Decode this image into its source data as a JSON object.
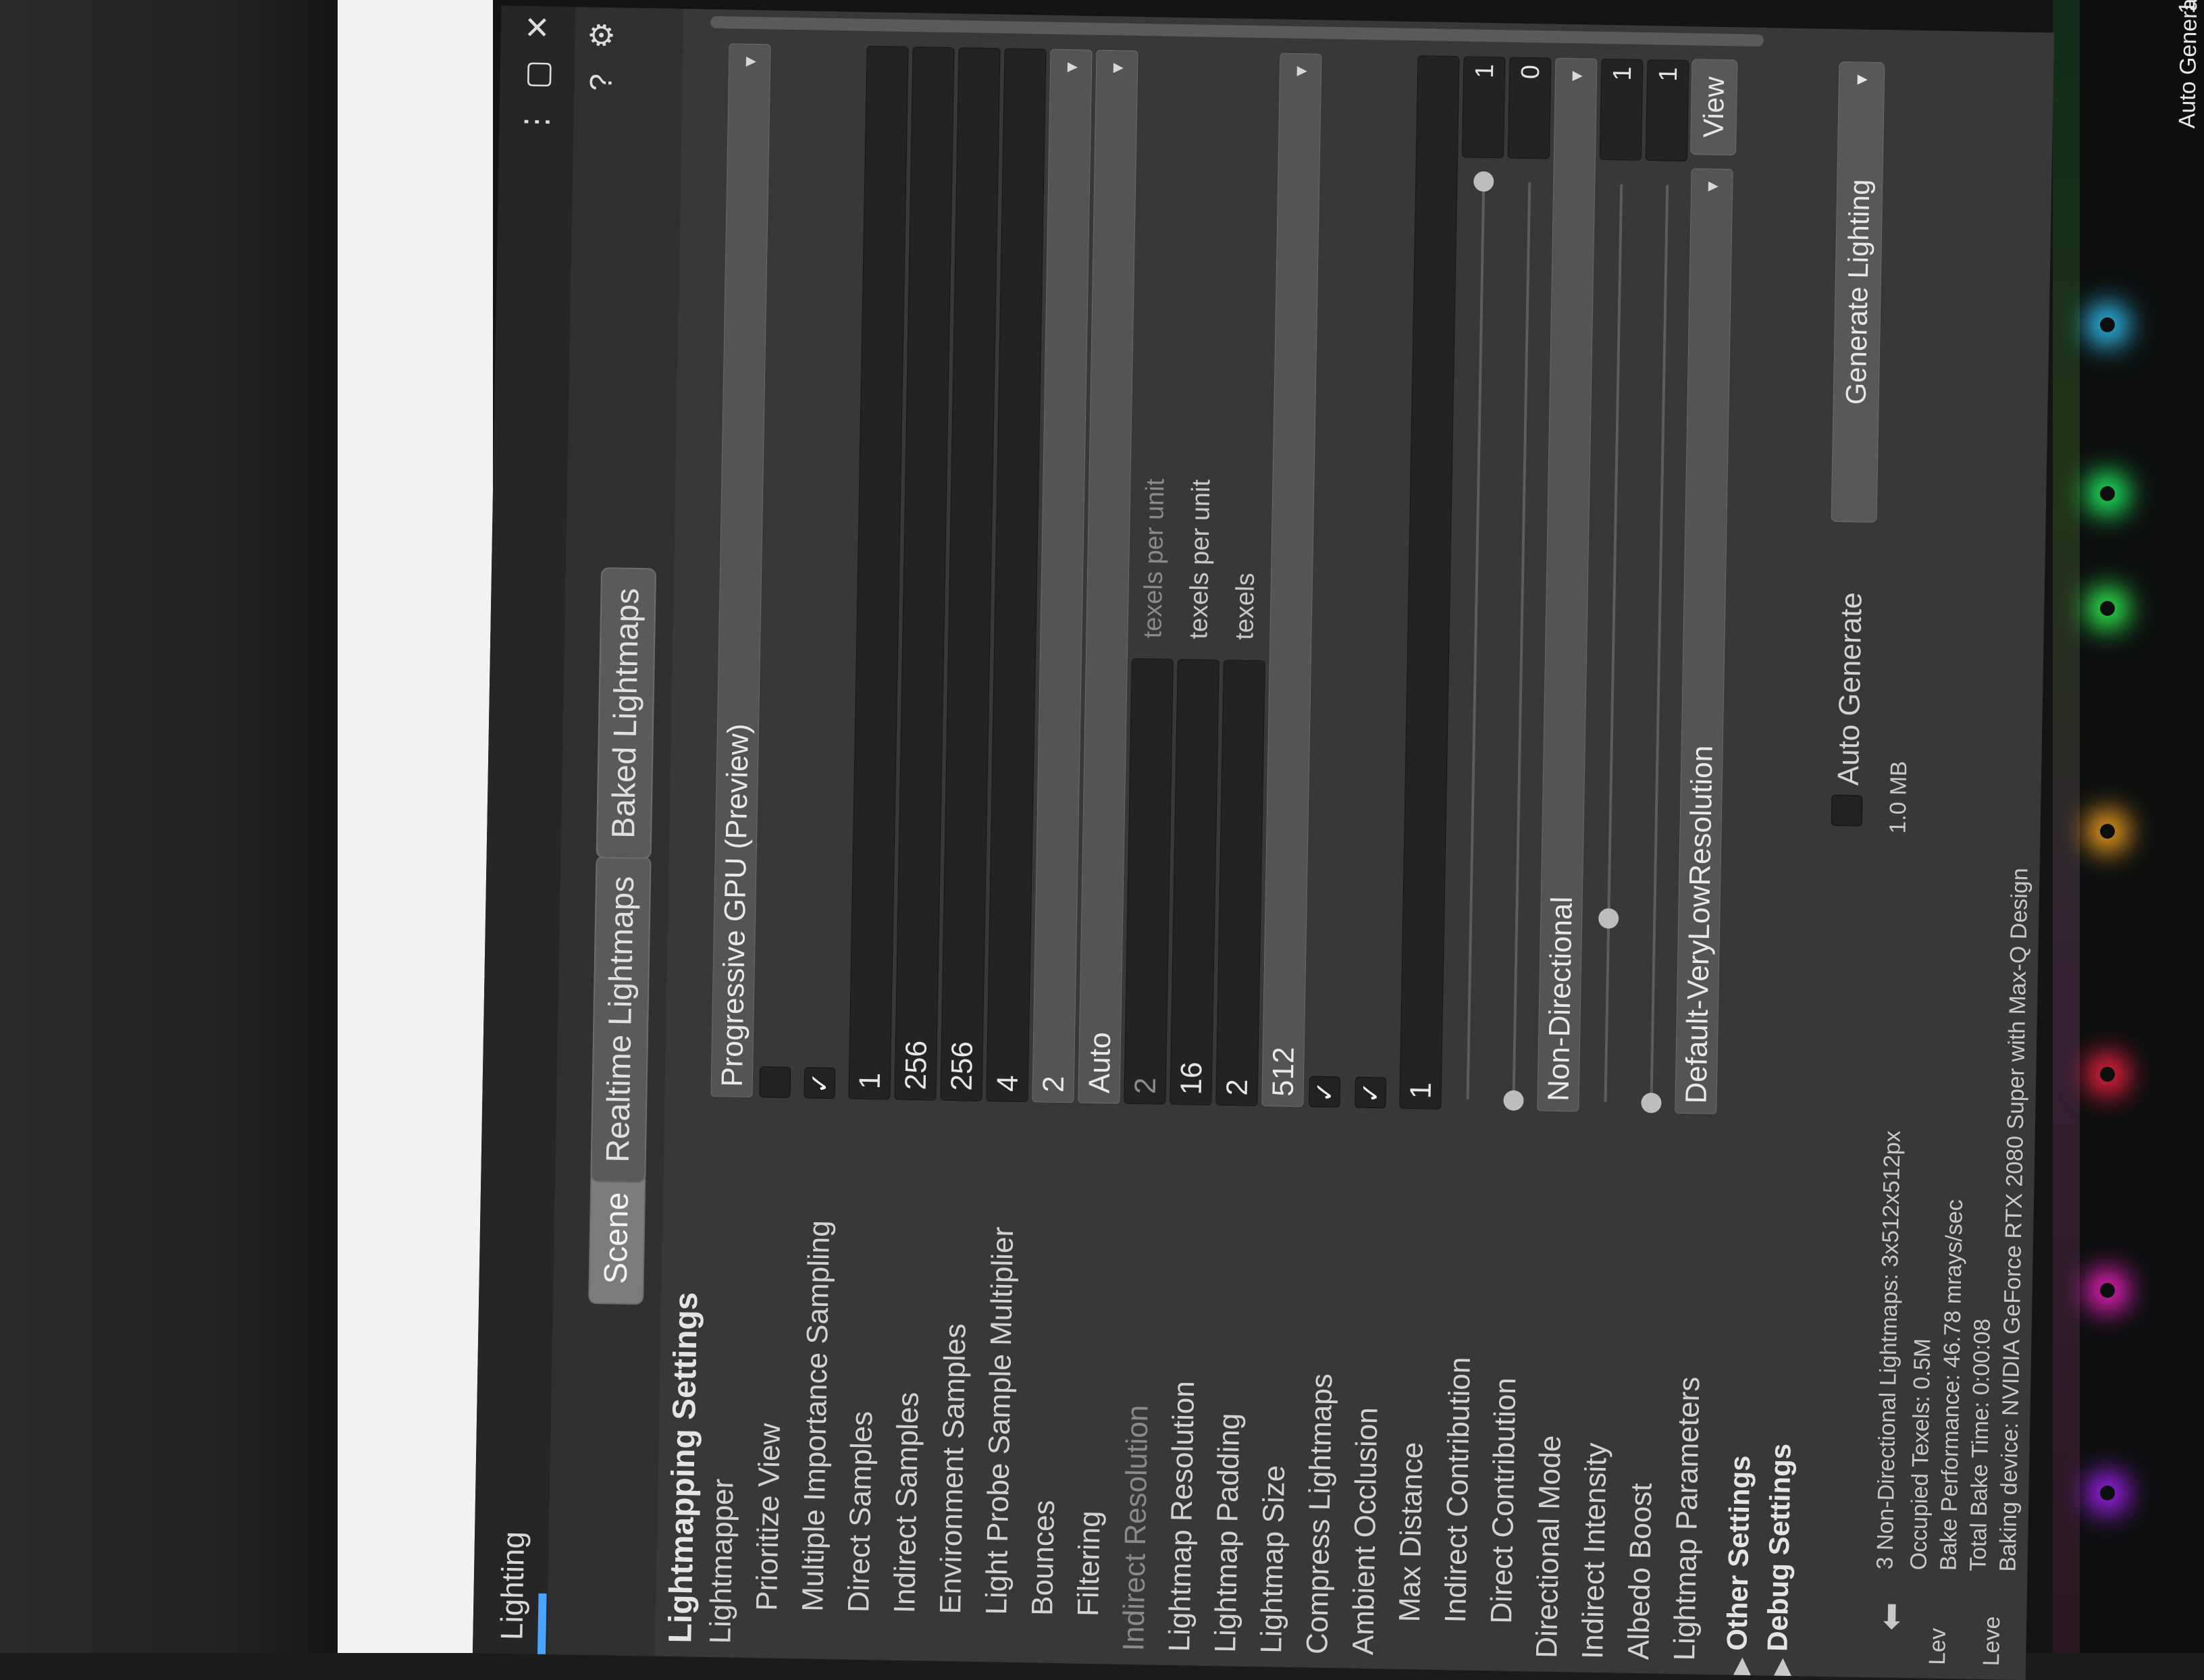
{
  "window": {
    "title": "Lighting",
    "menu_icon": "kebab-menu-icon",
    "maximize_icon": "maximize-icon",
    "close_icon": "close-icon",
    "close_glyph": "✕",
    "help_icon": "help-icon",
    "help_glyph": "?",
    "settings_icon": "gear-icon",
    "settings_glyph": "⚙",
    "kebab_glyph": "⋮",
    "maximize_glyph": "▢",
    "accent_color": "#4aa3ff"
  },
  "tabs": [
    {
      "label": "Scene",
      "active": true
    },
    {
      "label": "Realtime Lightmaps",
      "active": false
    },
    {
      "label": "Baked Lightmaps",
      "active": false
    }
  ],
  "section": {
    "title": "Lightmapping Settings"
  },
  "rows": {
    "lightmapper": {
      "label": "Lightmapper",
      "value": "Progressive GPU (Preview)"
    },
    "prioritize_view": {
      "label": "Prioritize View",
      "checked": false
    },
    "mis": {
      "label": "Multiple Importance Sampling",
      "checked": true,
      "glyph": "✓"
    },
    "direct_samples": {
      "label": "Direct Samples",
      "value": "1"
    },
    "indirect_samples": {
      "label": "Indirect Samples",
      "value": "256"
    },
    "environment_samples": {
      "label": "Environment Samples",
      "value": "256"
    },
    "probe_multiplier": {
      "label": "Light Probe Sample Multiplier",
      "value": "4"
    },
    "bounces": {
      "label": "Bounces",
      "value": "2"
    },
    "filtering": {
      "label": "Filtering",
      "value": "Auto"
    },
    "indirect_resolution": {
      "label": "Indirect Resolution",
      "value": "2",
      "unit": "texels per unit"
    },
    "lightmap_resolution": {
      "label": "Lightmap Resolution",
      "value": "16",
      "unit": "texels per unit"
    },
    "lightmap_padding": {
      "label": "Lightmap Padding",
      "value": "2",
      "unit": "texels"
    },
    "lightmap_size": {
      "label": "Lightmap Size",
      "value": "512"
    },
    "compress_lightmaps": {
      "label": "Compress Lightmaps",
      "checked": true,
      "glyph": "✓"
    },
    "ambient_occlusion": {
      "label": "Ambient Occlusion",
      "checked": true,
      "glyph": "✓"
    },
    "max_distance": {
      "label": "Max Distance",
      "value": "1"
    },
    "indirect_contribution": {
      "label": "Indirect Contribution",
      "value": "1",
      "level": 1.0
    },
    "direct_contribution": {
      "label": "Direct Contribution",
      "value": "0",
      "level": 0.0
    },
    "directional_mode": {
      "label": "Directional Mode",
      "value": "Non-Directional"
    },
    "indirect_intensity": {
      "label": "Indirect Intensity",
      "value": "1",
      "level": 0.2
    },
    "albedo_boost": {
      "label": "Albedo Boost",
      "value": "1",
      "level": 0.0
    },
    "lightmap_parameters": {
      "label": "Lightmap Parameters",
      "value": "Default-VeryLowResolution",
      "view_button": "View"
    }
  },
  "foldouts": [
    {
      "label": "Other Settings",
      "glyph": "▶"
    },
    {
      "label": "Debug Settings",
      "glyph": "▶"
    }
  ],
  "generate": {
    "auto_generate_label": "Auto Generate",
    "auto_generate_checked": false,
    "button_label": "Generate Lighting",
    "caret": "▾"
  },
  "footer": {
    "lev1": "Lev",
    "lev2": "Leve",
    "lightmaps_info": "3 Non-Directional Lightmaps: 3x512x512px",
    "size": "1.0 MB",
    "occupied_texels": "Occupied Texels: 0.5M",
    "bake_performance": "Bake Performance: 46.78 mrays/sec",
    "total_bake_time": "Total Bake Time: 0:00:08",
    "baking_device": "Baking device: NVIDIA GeForce RTX 2080 Super with Max-Q Design",
    "arrow_glyph": "⬅"
  },
  "taskbar": {
    "tray_text": "Auto Genera",
    "clock_fragment": "12"
  },
  "caret_glyph": "▾"
}
